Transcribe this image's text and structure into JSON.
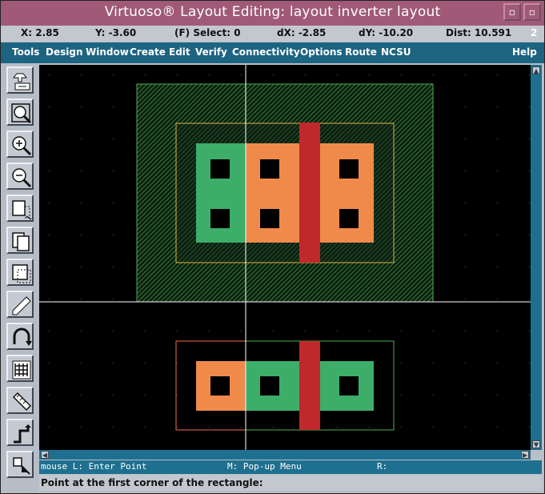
{
  "window": {
    "title": "Virtuoso® Layout Editing: layout inverter layout",
    "minimize_glyph": "▫",
    "maximize_glyph": "▫"
  },
  "status": {
    "x": "X:  2.85",
    "y": "Y:  -3.60",
    "select": "(F) Select: 0",
    "dx": "dX:  -2.85",
    "dy": "dY:  -10.20",
    "dist": "Dist:  10.591",
    "window_num": "2"
  },
  "menu": [
    "Tools",
    "Design",
    "Window",
    "Create",
    "Edit",
    "Verify",
    "Connectivity",
    "Options",
    "Route",
    "NCSU",
    "Help"
  ],
  "tools": [
    {
      "name": "save-icon"
    },
    {
      "name": "zoom-fit-icon"
    },
    {
      "name": "zoom-in-icon"
    },
    {
      "name": "zoom-out-icon"
    },
    {
      "name": "stretch-icon"
    },
    {
      "name": "copy-icon"
    },
    {
      "name": "move-icon"
    },
    {
      "name": "delete-icon"
    },
    {
      "name": "undo-icon"
    },
    {
      "name": "properties-icon"
    },
    {
      "name": "ruler-icon"
    },
    {
      "name": "path-icon"
    },
    {
      "name": "rectangle-icon"
    }
  ],
  "colors": {
    "canvas": "#000000",
    "nwell": "#4caf50",
    "active_green": "#3cae6a",
    "active_orange": "#f08a4b",
    "poly": "#c0282c",
    "select_outline": "#f26b4a",
    "panel_blue": "#1f7090",
    "title": "#a05a78"
  },
  "mouse": {
    "left": "mouse L: Enter Point",
    "middle": "M: Pop-up Menu",
    "right": "R:"
  },
  "prompt": "Point at the first corner of the rectangle:"
}
